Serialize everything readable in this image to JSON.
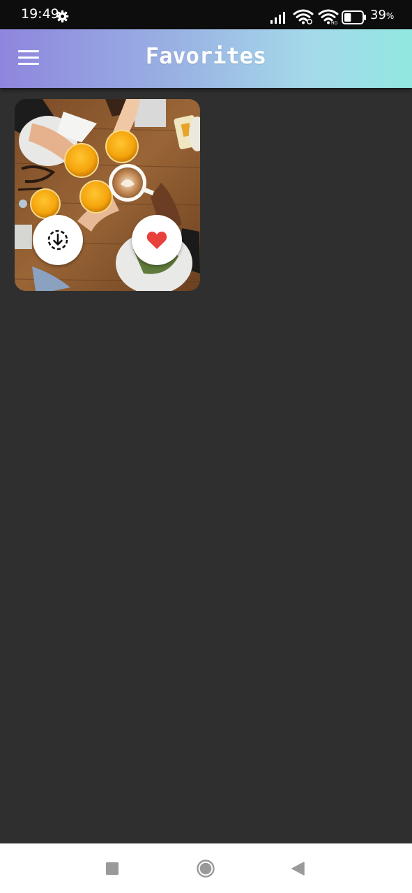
{
  "status_bar": {
    "time": "19:49",
    "battery_percent": "39",
    "battery_unit": "%",
    "battery_level": 0.39,
    "icons": [
      "gear-icon",
      "signal-icon",
      "wifi-icon",
      "wifi-call-icon",
      "battery-icon"
    ]
  },
  "app_bar": {
    "title": "Favorites",
    "menu_icon": "hamburger-menu-icon",
    "gradient_colors": [
      "#8e86de",
      "#92e7e1"
    ]
  },
  "favorites": {
    "items": [
      {
        "image": "brunch-drinks-photo",
        "actions": [
          {
            "name": "download",
            "icon": "download-icon"
          },
          {
            "name": "favorite",
            "icon": "heart-icon",
            "color": "#e8403a",
            "active": true
          }
        ]
      }
    ]
  },
  "nav_bar": {
    "buttons": [
      "recent-apps-icon",
      "home-icon",
      "back-icon"
    ]
  },
  "colors": {
    "background": "#2f2f2f",
    "status_bar": "#0d0d0d",
    "heart": "#e8403a"
  }
}
